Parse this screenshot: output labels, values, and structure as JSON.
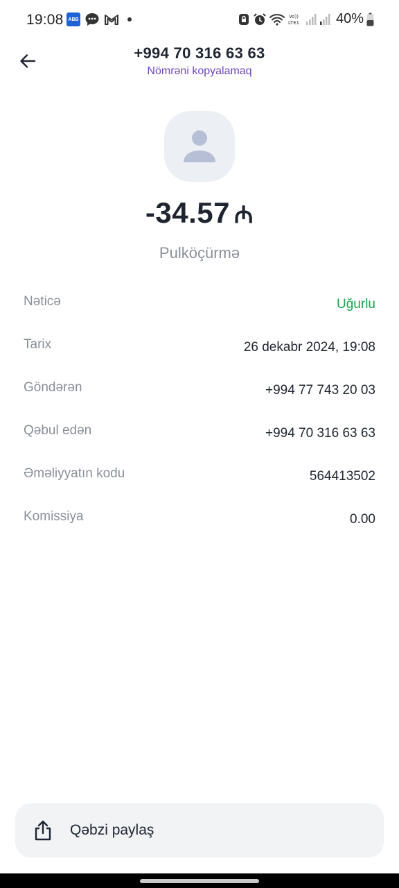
{
  "status_bar": {
    "time": "19:08",
    "abb_badge": "ABB",
    "battery": "40%",
    "icons": [
      "abb-icon",
      "messages-icon",
      "gmail-icon",
      "screenshot-lock-icon",
      "alarm-icon",
      "wifi-icon",
      "volte-lte-icon",
      "signal-icon",
      "signal-icon",
      "battery-icon"
    ]
  },
  "header": {
    "phone": "+994 70 316 63 63",
    "copy_label": "Nömrəni kopyalamaq"
  },
  "transaction": {
    "amount": "-34.57",
    "currency": "₼",
    "type": "Pulköçürmə"
  },
  "details": [
    {
      "label": "Nəticə",
      "value": "Uğurlu"
    },
    {
      "label": "Tarix",
      "value": "26 dekabr 2024, 19:08"
    },
    {
      "label": "Göndərən",
      "value": "+994 77 743 20 03"
    },
    {
      "label": "Qəbul edən",
      "value": "+994 70 316 63 63"
    },
    {
      "label": "Əməliyyatın kodu",
      "value": "564413502"
    },
    {
      "label": "Komissiya",
      "value": "0.00"
    }
  ],
  "share": {
    "label": "Qəbzi paylaş"
  },
  "colors": {
    "accent": "#6b46c1",
    "success": "#1aa34a",
    "text": "#1f2530",
    "muted": "#8a8f98"
  }
}
